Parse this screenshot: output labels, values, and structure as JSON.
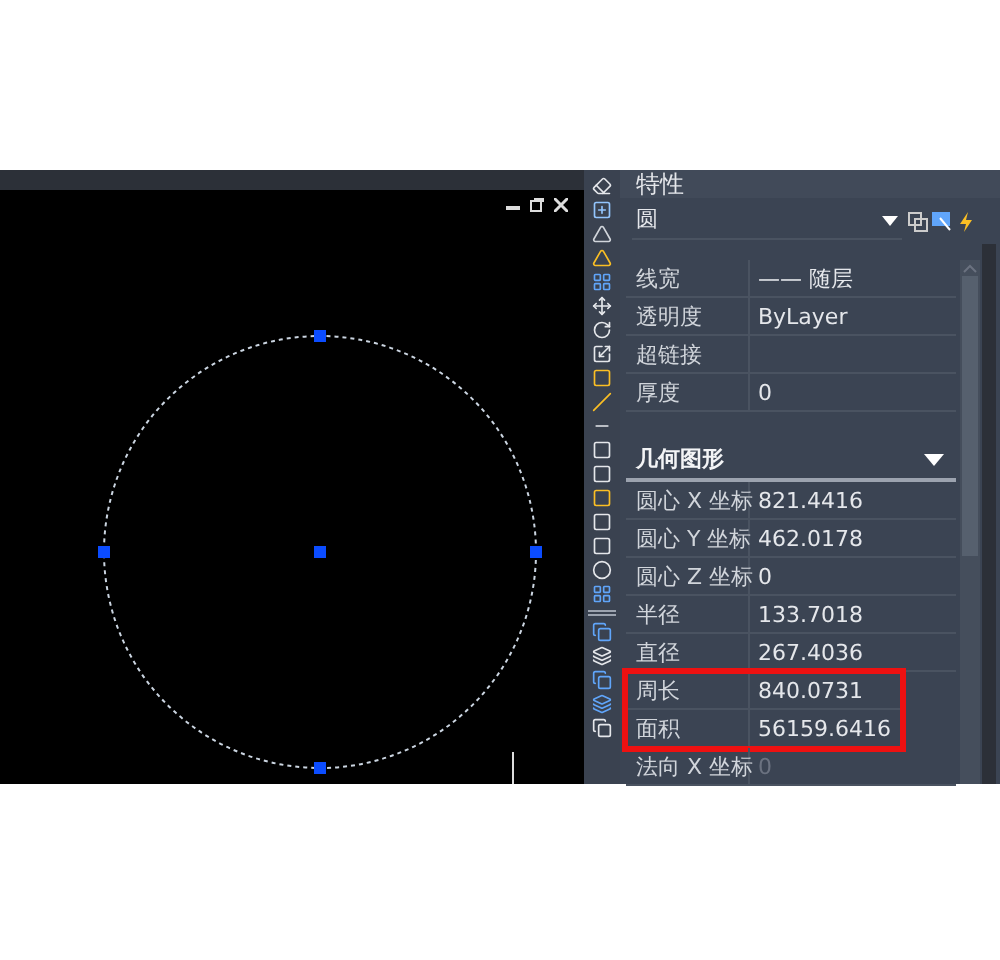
{
  "panel": {
    "title": "特性",
    "object_type": "圆"
  },
  "general_rows": [
    {
      "label": "线宽",
      "value": "—— 随层"
    },
    {
      "label": "透明度",
      "value": "ByLayer"
    },
    {
      "label": "超链接",
      "value": ""
    },
    {
      "label": "厚度",
      "value": "0"
    }
  ],
  "section": {
    "title": "几何图形",
    "expanded": true
  },
  "geometry_rows": [
    {
      "label": "圆心 X 坐标",
      "value": "821.4416",
      "disabled": false,
      "highlighted": false
    },
    {
      "label": "圆心 Y 坐标",
      "value": "462.0178",
      "disabled": false,
      "highlighted": false
    },
    {
      "label": "圆心 Z 坐标",
      "value": "0",
      "disabled": false,
      "highlighted": false
    },
    {
      "label": "半径",
      "value": "133.7018",
      "disabled": false,
      "highlighted": false
    },
    {
      "label": "直径",
      "value": "267.4036",
      "disabled": false,
      "highlighted": false
    },
    {
      "label": "周长",
      "value": "840.0731",
      "disabled": false,
      "highlighted": true
    },
    {
      "label": "面积",
      "value": "56159.6416",
      "disabled": false,
      "highlighted": true
    },
    {
      "label": "法向 X 坐标",
      "value": "0",
      "disabled": true,
      "highlighted": false
    }
  ]
}
